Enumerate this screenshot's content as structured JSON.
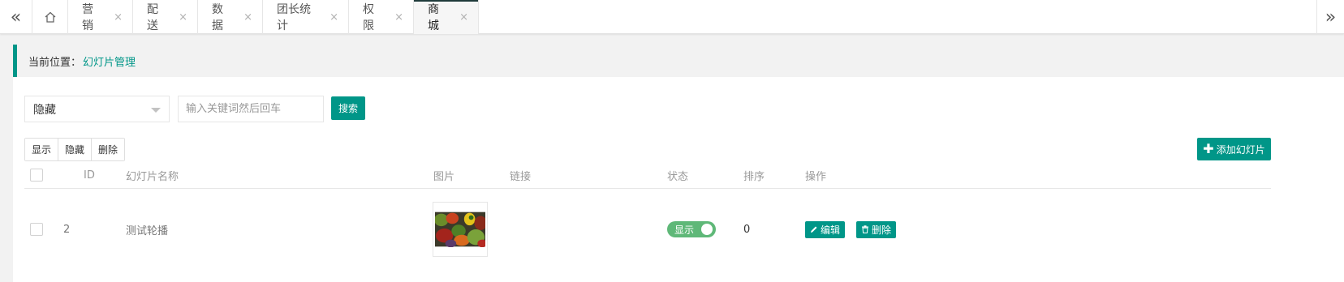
{
  "tabbar": {
    "tabs": [
      {
        "label": "营销"
      },
      {
        "label": "配送"
      },
      {
        "label": "数据"
      },
      {
        "label": "团长统计"
      },
      {
        "label": "权限"
      },
      {
        "label": "商城"
      }
    ],
    "close_glyph": "×"
  },
  "breadcrumb": {
    "current_label": "当前位置：",
    "page": "幻灯片管理"
  },
  "filters": {
    "status_select": "隐藏",
    "search_placeholder": "输入关键词然后回车",
    "search_button": "搜索"
  },
  "batch_actions": [
    "显示",
    "隐藏",
    "删除"
  ],
  "add_button": "添加幻灯片",
  "table": {
    "columns": {
      "id": "ID",
      "name": "幻灯片名称",
      "image": "图片",
      "link": "链接",
      "status": "状态",
      "sort": "排序",
      "actions": "操作"
    },
    "rows": [
      {
        "id": "2",
        "name": "测试轮播",
        "link": "",
        "status": "显示",
        "sort": "0",
        "edit": "编辑",
        "delete": "删除"
      }
    ]
  },
  "colors": {
    "primary": "#009688",
    "switch_on": "#5fb878"
  }
}
